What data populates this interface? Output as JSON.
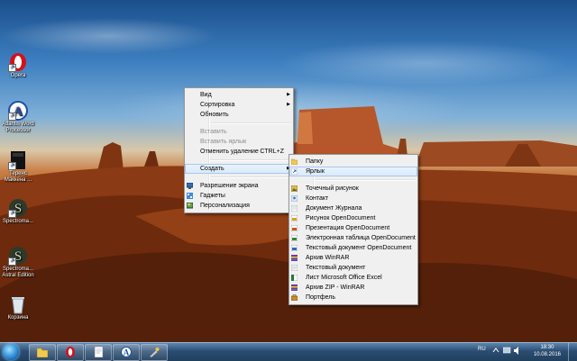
{
  "desktop_icons": [
    {
      "label": "Opera",
      "icon": "opera-icon"
    },
    {
      "label": "Atlantis Word Processor",
      "icon": "atlantis-icon"
    },
    {
      "label": "Теренс Маккена ...",
      "icon": "file-icon"
    },
    {
      "label": "Spectroma...",
      "icon": "spectroma-icon"
    },
    {
      "label": "Spectroma... Astral Edition",
      "icon": "spectroma-icon"
    },
    {
      "label": "Корзина",
      "icon": "recycle-bin-icon"
    }
  ],
  "context_menu": {
    "view": "Вид",
    "sort": "Сортировка",
    "refresh": "Обновить",
    "paste": "Вставить",
    "paste_shortcut": "Вставить ярлык",
    "undo_delete": "Отменить удаление",
    "undo_shortcut": "CTRL+Z",
    "create": "Создать",
    "resolution": "Разрешение экрана",
    "gadgets": "Гаджеты",
    "personalize": "Персонализация"
  },
  "submenu": {
    "items": [
      "Папку",
      "Ярлык",
      "Точечный рисунок",
      "Контакт",
      "Документ Журнала",
      "Рисунок OpenDocument",
      "Презентация OpenDocument",
      "Электронная таблица OpenDocument",
      "Текстовый документ OpenDocument",
      "Архив WinRAR",
      "Текстовый документ",
      "Лист Microsoft Office Excel",
      "Архив ZIP - WinRAR",
      "Портфель"
    ],
    "highlighted": "Ярлык"
  },
  "taskbar": {
    "pinned": [
      "explorer-icon",
      "opera-icon",
      "documents-icon",
      "atlantis-icon",
      "tool-icon"
    ],
    "language": "RU",
    "time": "18:30",
    "date": "10.08.2016"
  }
}
